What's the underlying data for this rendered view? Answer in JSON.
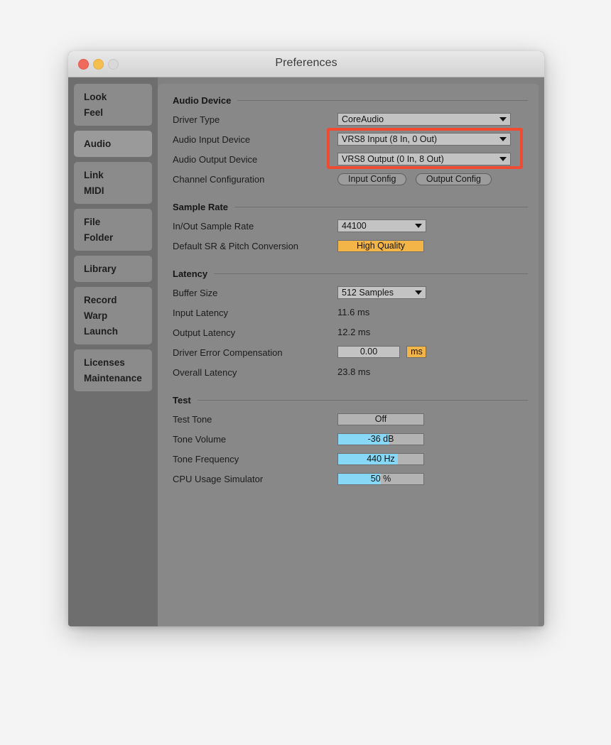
{
  "window": {
    "title": "Preferences",
    "controls": {
      "close": "close",
      "minimize": "minimize",
      "zoom": "zoom"
    }
  },
  "sidebar": {
    "groups": [
      {
        "selected": false,
        "items": [
          "Look",
          "Feel"
        ]
      },
      {
        "selected": true,
        "items": [
          "Audio"
        ]
      },
      {
        "selected": false,
        "items": [
          "Link",
          "MIDI"
        ]
      },
      {
        "selected": false,
        "items": [
          "File",
          "Folder"
        ]
      },
      {
        "selected": false,
        "items": [
          "Library"
        ]
      },
      {
        "selected": false,
        "items": [
          "Record",
          "Warp",
          "Launch"
        ]
      },
      {
        "selected": false,
        "items": [
          "Licenses",
          "Maintenance"
        ]
      }
    ]
  },
  "sections": {
    "audio_device": {
      "title": "Audio Device",
      "driver_type": {
        "label": "Driver Type",
        "value": "CoreAudio"
      },
      "audio_input_device": {
        "label": "Audio Input Device",
        "value": "VRS8 Input (8 In, 0 Out)"
      },
      "audio_output_device": {
        "label": "Audio Output Device",
        "value": "VRS8 Output (0 In, 8 Out)"
      },
      "channel_configuration": {
        "label": "Channel Configuration",
        "input_button": "Input Config",
        "output_button": "Output Config"
      }
    },
    "sample_rate": {
      "title": "Sample Rate",
      "in_out_sample_rate": {
        "label": "In/Out Sample Rate",
        "value": "44100"
      },
      "default_sr_pitch_conversion": {
        "label": "Default SR & Pitch Conversion",
        "value": "High Quality"
      }
    },
    "latency": {
      "title": "Latency",
      "buffer_size": {
        "label": "Buffer Size",
        "value": "512 Samples"
      },
      "input_latency": {
        "label": "Input Latency",
        "value": "11.6 ms"
      },
      "output_latency": {
        "label": "Output Latency",
        "value": "12.2 ms"
      },
      "driver_error_compensation": {
        "label": "Driver Error Compensation",
        "value": "0.00",
        "unit": "ms"
      },
      "overall_latency": {
        "label": "Overall Latency",
        "value": "23.8 ms"
      }
    },
    "test": {
      "title": "Test",
      "test_tone": {
        "label": "Test Tone",
        "value": "Off",
        "fill_percent": 0
      },
      "tone_volume": {
        "label": "Tone Volume",
        "value": "-36 dB",
        "fill_percent": 60
      },
      "tone_frequency": {
        "label": "Tone Frequency",
        "value": "440 Hz",
        "fill_percent": 70
      },
      "cpu_usage_simulator": {
        "label": "CPU Usage Simulator",
        "value": "50 %",
        "fill_percent": 50
      }
    }
  },
  "annotation": {
    "highlight_color": "#f04a32",
    "highlights": [
      "Audio Input Device",
      "Audio Output Device"
    ]
  },
  "colors": {
    "accent_orange": "#f3b548",
    "slider_blue": "#87d8f7",
    "window_bg": "#808080",
    "panel_bg": "#888888",
    "sidebar_bg": "#6e6e6e"
  }
}
